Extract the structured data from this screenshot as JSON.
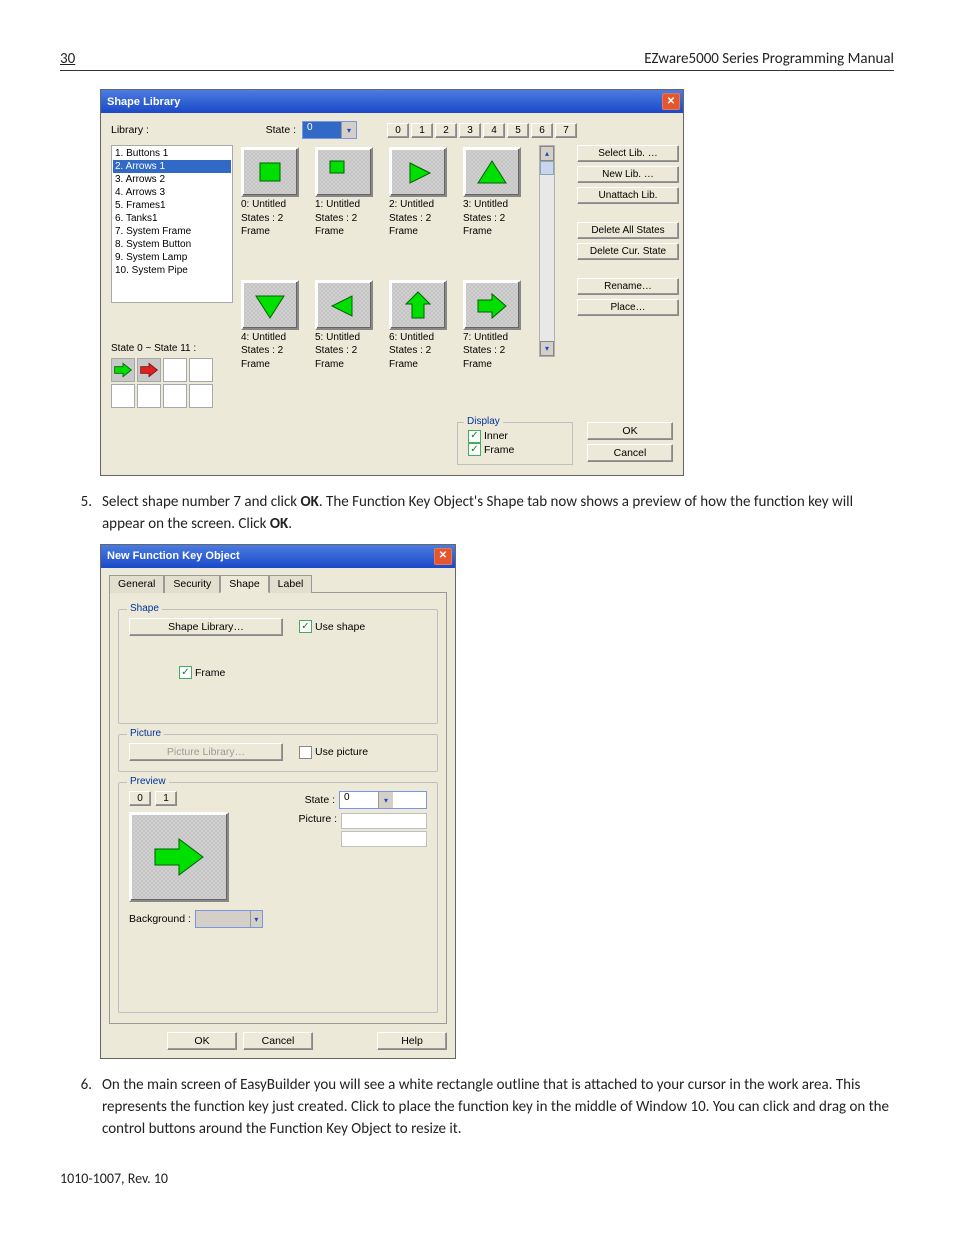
{
  "header": {
    "page": "30",
    "title": "EZware5000 Series Programming Manual"
  },
  "footer": "1010-1007, Rev. 10",
  "steps": {
    "s5": {
      "num": "5.",
      "text_a": "Select shape number 7 and click ",
      "bold1": "OK",
      "text_b": ". The Function Key Object's Shape tab now shows a preview of how the function key will appear on the screen. Click ",
      "bold2": "OK",
      "text_c": "."
    },
    "s6": {
      "num": "6.",
      "text": "On the main screen of EasyBuilder you will see a white rectangle outline that is attached to your cursor in the work area. This represents the function key just created. Click to place the function key in the middle of Window 10. You can click and drag on the control buttons around the Function Key Object to resize it."
    }
  },
  "dlg1": {
    "title": "Shape Library",
    "library_label": "Library :",
    "state_label": "State :",
    "state_value": "0",
    "state_buttons": [
      "0",
      "1",
      "2",
      "3",
      "4",
      "5",
      "6",
      "7"
    ],
    "lib_items": [
      "1. Buttons 1",
      "2. Arrows 1",
      "3. Arrows 2",
      "4. Arrows 3",
      "5. Frames1",
      "6. Tanks1",
      "7. System Frame",
      "8. System Button",
      "9. System Lamp",
      "10. System Pipe"
    ],
    "lib_selected_index": 1,
    "state_range_label": "State 0 ~ State 11 :",
    "thumbs": [
      {
        "name": "0: Untitled",
        "l2": "States : 2",
        "l3": "Frame",
        "shape": "square"
      },
      {
        "name": "1: Untitled",
        "l2": "States : 2",
        "l3": "Frame",
        "shape": "square-tl"
      },
      {
        "name": "2: Untitled",
        "l2": "States : 2",
        "l3": "Frame",
        "shape": "tri-right"
      },
      {
        "name": "3: Untitled",
        "l2": "States : 2",
        "l3": "Frame",
        "shape": "tri-up"
      },
      {
        "name": "4: Untitled",
        "l2": "States : 2",
        "l3": "Frame",
        "shape": "tri-down"
      },
      {
        "name": "5: Untitled",
        "l2": "States : 2",
        "l3": "Frame",
        "shape": "tri-left"
      },
      {
        "name": "6: Untitled",
        "l2": "States : 2",
        "l3": "Frame",
        "shape": "arrow-up"
      },
      {
        "name": "7: Untitled",
        "l2": "States : 2",
        "l3": "Frame",
        "shape": "arrow-right"
      }
    ],
    "side_buttons": [
      "Select Lib. …",
      "New Lib. …",
      "Unattach Lib.",
      "Delete All States",
      "Delete Cur. State",
      "Rename…",
      "Place…"
    ],
    "display_label": "Display",
    "chk_inner": "Inner",
    "chk_frame": "Frame",
    "ok": "OK",
    "cancel": "Cancel"
  },
  "dlg2": {
    "title": "New  Function Key Object",
    "tabs": [
      "General",
      "Security",
      "Shape",
      "Label"
    ],
    "active_tab": 2,
    "grp_shape": "Shape",
    "btn_shape_lib": "Shape Library…",
    "chk_use_shape": "Use shape",
    "chk_frame": "Frame",
    "grp_picture": "Picture",
    "btn_pic_lib": "Picture Library…",
    "chk_use_pic": "Use picture",
    "grp_preview": "Preview",
    "state_btns": [
      "0",
      "1"
    ],
    "state_label": "State :",
    "state_value": "0",
    "picture_label": "Picture :",
    "bg_label": "Background :",
    "ok": "OK",
    "cancel": "Cancel",
    "help": "Help"
  }
}
